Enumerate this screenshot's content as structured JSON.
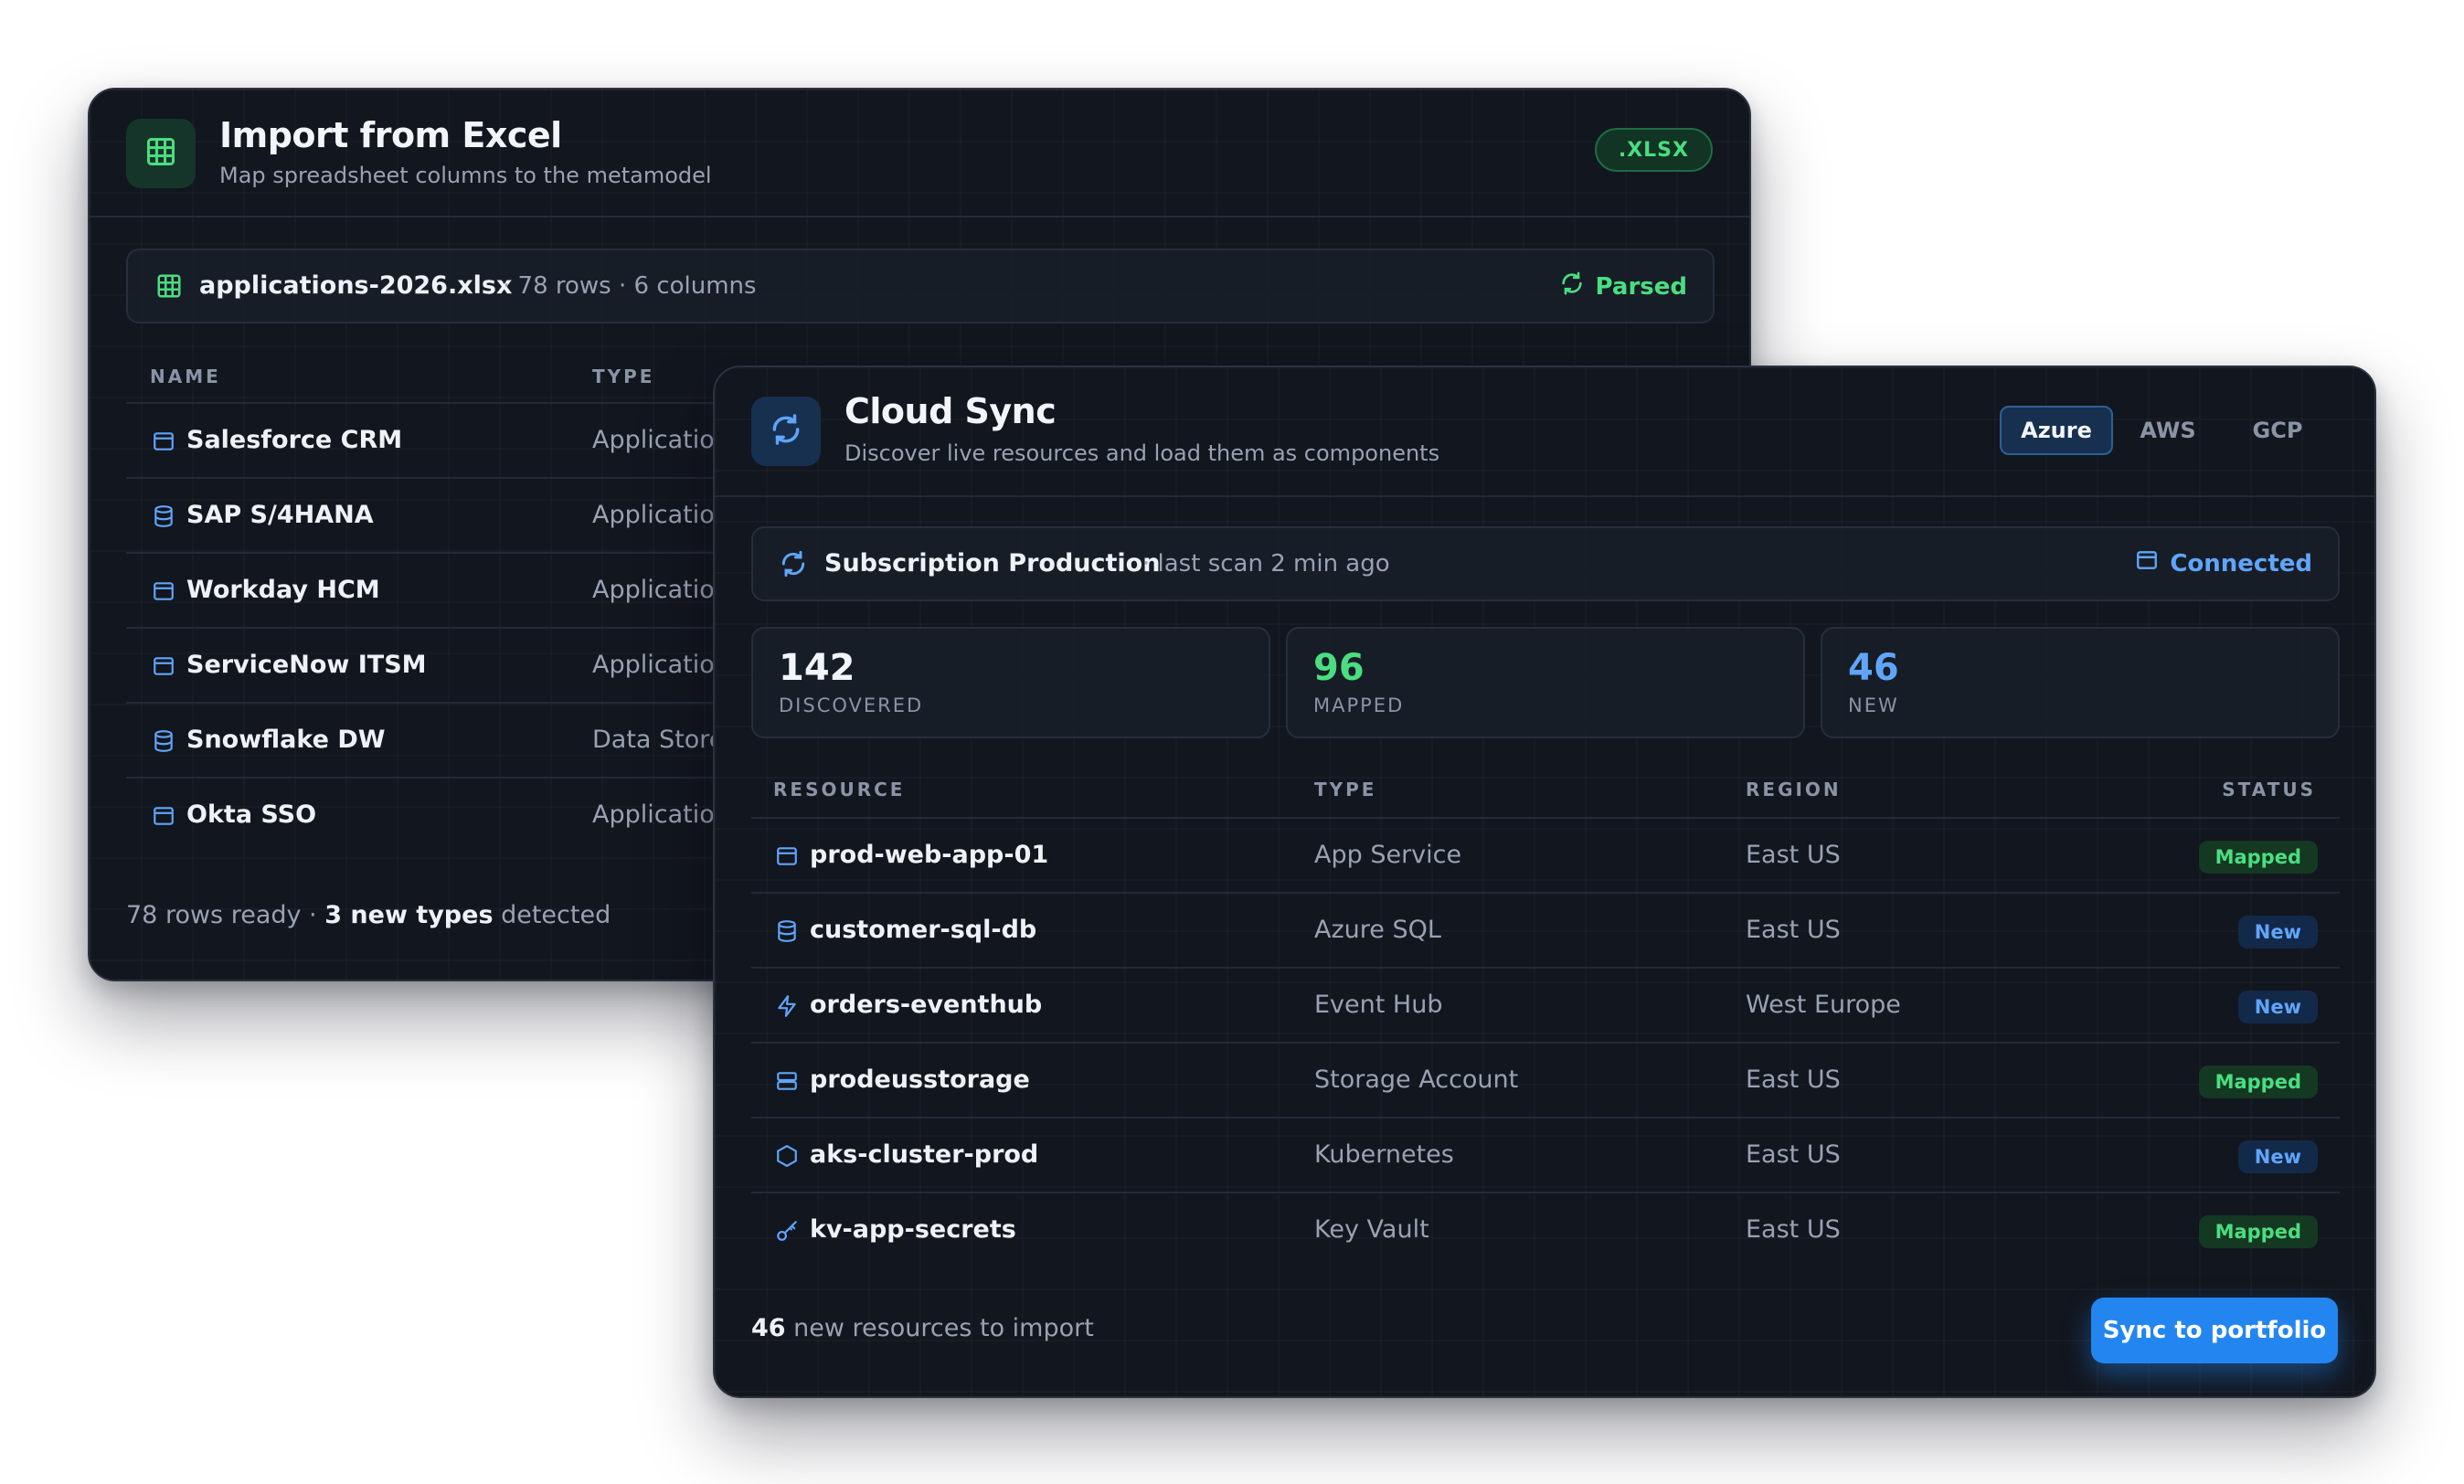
{
  "excel": {
    "title": "Import from Excel",
    "subtitle": "Map spreadsheet columns to the metamodel",
    "badge": ".XLSX",
    "file": {
      "name": "applications-2026.xlsx",
      "meta": "· 78 rows · 6 columns",
      "status": "Parsed"
    },
    "columns": [
      "NAME",
      "TYPE"
    ],
    "rows": [
      {
        "name": "Salesforce CRM",
        "type": "Application",
        "icon": "window-icon"
      },
      {
        "name": "SAP S/4HANA",
        "type": "Application",
        "icon": "database-icon"
      },
      {
        "name": "Workday HCM",
        "type": "Application",
        "icon": "window-icon"
      },
      {
        "name": "ServiceNow ITSM",
        "type": "Application",
        "icon": "window-icon"
      },
      {
        "name": "Snowflake DW",
        "type": "Data Store",
        "icon": "database-icon"
      },
      {
        "name": "Okta SSO",
        "type": "Application",
        "icon": "window-icon"
      }
    ],
    "footer": {
      "count": "78 rows ready · ",
      "highlight": "3 new types",
      "rest": " detected"
    }
  },
  "cloud": {
    "title": "Cloud Sync",
    "subtitle": "Discover live resources and load them as components",
    "providers": [
      "Azure",
      "AWS",
      "GCP"
    ],
    "active_provider": "Azure",
    "subscription": {
      "name": "Subscription Production",
      "meta": "· last scan 2 min ago",
      "status": "Connected"
    },
    "stats": [
      {
        "value": "142",
        "label": "DISCOVERED",
        "color": "#f2f5f9"
      },
      {
        "value": "96",
        "label": "MAPPED",
        "color": "#4ade80"
      },
      {
        "value": "46",
        "label": "NEW",
        "color": "#60a5fa"
      }
    ],
    "columns": [
      "RESOURCE",
      "TYPE",
      "REGION",
      "STATUS"
    ],
    "rows": [
      {
        "name": "prod-web-app-01",
        "type": "App Service",
        "region": "East US",
        "status": "Mapped",
        "icon": "window-icon"
      },
      {
        "name": "customer-sql-db",
        "type": "Azure SQL",
        "region": "East US",
        "status": "New",
        "icon": "database-icon"
      },
      {
        "name": "orders-eventhub",
        "type": "Event Hub",
        "region": "West Europe",
        "status": "New",
        "icon": "lightning-icon"
      },
      {
        "name": "prodeusstorage",
        "type": "Storage Account",
        "region": "East US",
        "status": "Mapped",
        "icon": "server-icon"
      },
      {
        "name": "aks-cluster-prod",
        "type": "Kubernetes",
        "region": "East US",
        "status": "New",
        "icon": "hexagon-icon"
      },
      {
        "name": "kv-app-secrets",
        "type": "Key Vault",
        "region": "East US",
        "status": "Mapped",
        "icon": "key-icon"
      }
    ],
    "footer": {
      "count": "46",
      "rest": " new resources to import"
    },
    "cta": "Sync to portfolio"
  },
  "colors": {
    "green": "#4ade80",
    "blue": "#60a5fa",
    "accent": "#2386f0",
    "card": "#12161e"
  }
}
